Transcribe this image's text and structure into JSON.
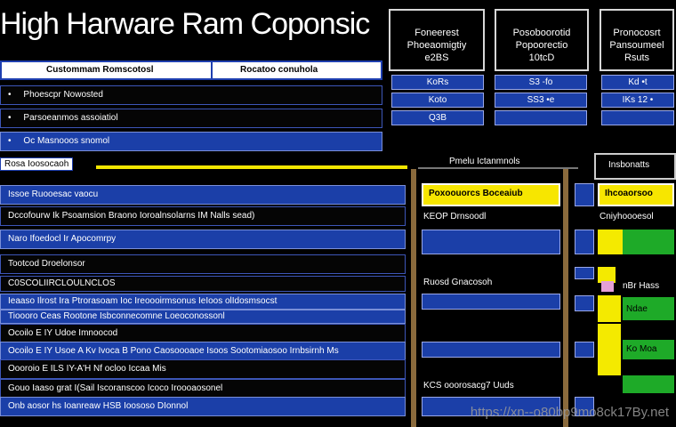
{
  "title": "High Harware Ram Coponsic",
  "header": {
    "col1": "Custommam Romscotosl",
    "col2": "Rocatoo conuhola"
  },
  "top_rows": [
    {
      "bullet": "•",
      "text": "Phoescpr Nowosted"
    },
    {
      "bullet": "•",
      "text": "Parsoeanmos assoiatiol"
    },
    {
      "bullet": "•",
      "text": "Oc Masnooos snomol"
    }
  ],
  "cards": [
    {
      "title": "Foneerest Phoeaomigtiy",
      "sub": "e2BS",
      "cells": [
        "KoRs",
        "Koto",
        "Q3B"
      ]
    },
    {
      "title": "Posoboorotid Popoorectio",
      "sub": "10tcD",
      "cells": [
        "S3 -fo",
        "SS3 •e",
        ""
      ]
    },
    {
      "title": "Pronocosrt Pansoumeel",
      "sub": "Rsuts",
      "cells": [
        "Kd •t",
        "IKs 12 •",
        ""
      ]
    }
  ],
  "section_label": "Rosa  Ioosocaoh",
  "mid_label": "Pmelu  Ictanmnols",
  "right_label": "Insbonatts",
  "main_rows": [
    {
      "text": "Issoe  Ruooesac  vaocu",
      "dark": false
    },
    {
      "text": "Dccofourw Ik  Psoamsion  Braono  Ioroalnsolarns  IM  Nalls  sead)",
      "dark": true
    },
    {
      "text": "Naro  Ifoedocl   Ir  Apocomrpy",
      "dark": false
    },
    {
      "text": "Tootcod  Droelonsor",
      "dark": true
    },
    {
      "text": "C0SCOLIIRCLOULNCLOS",
      "dark": true
    },
    {
      "text": "Ieaaso  Ilrost  Ira  Ptrorasoam Ioc  Ireoooirmsonus   IeIoos olIdosmsocst",
      "dark": false
    },
    {
      "text": "Tioooro  Ceas  Rootone  Isbconnecomne  Loeoconossonl",
      "dark": false
    },
    {
      "text": "Ocoilo  E  IY  Udoe  Imnoocod",
      "dark": true
    },
    {
      "text": "Ocoilo  E  IY  Usoe  A  Kv  Ivoca   B  Pono  Caosoooaoe   Isoos  Sootomiaosoo  Irnbsirnh  Ms",
      "dark": false
    },
    {
      "text": "Oooroio  E  ILS  IY-A'H  Nf  ocloo  Iccaa  Mis",
      "dark": true
    },
    {
      "text": "Gouo  Iaaso  grat  I(Sail  Iscoranscoo  Icoco  Iroooaosonel",
      "dark": true
    },
    {
      "text": "Onb  aosor  hs  Ioanreaw  HSB  Ioososo  DIonnol",
      "dark": false
    }
  ],
  "mid_boxes": {
    "yellow": "Poxoouorcs  Boceaiub",
    "l1": "KEOP  Drnsoodl",
    "l2": "Ruosd  Gnacosoh",
    "l3": "KCS  ooorosacg7  Uuds"
  },
  "right_boxes": {
    "yellow": "Ihcoaorsoo",
    "l1": "Cniyhoooesol",
    "g1": "nBr  Hass",
    "g2": "Ndae",
    "g3": "Ko  Moa"
  },
  "watermark": "https://xn--o80bp9mo8ck17By.net",
  "colors": {
    "blue": "#1b3fa8",
    "yellow": "#f2e600",
    "green": "#1eaa28"
  }
}
